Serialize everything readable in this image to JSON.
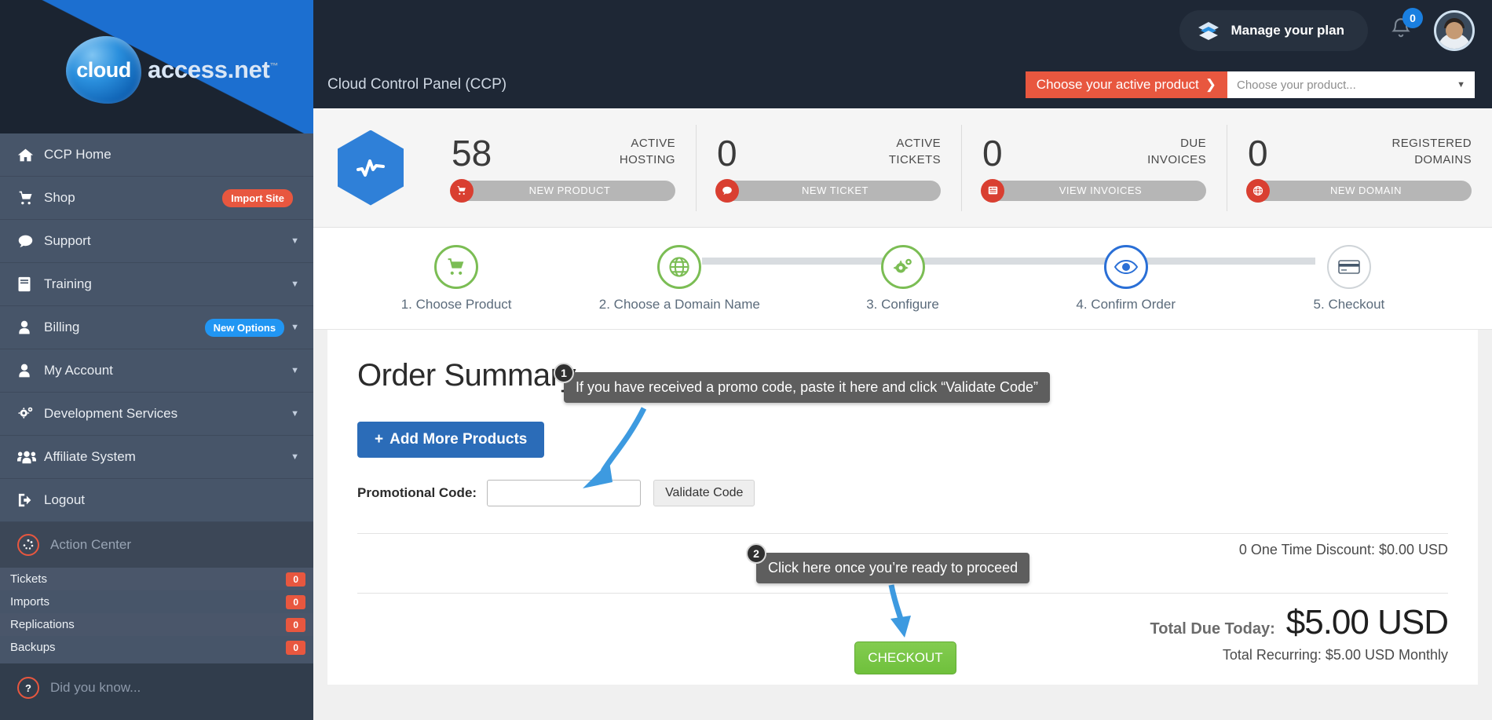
{
  "brand": {
    "logo_primary": "cloud",
    "logo_secondary": "access.net",
    "logo_tm": "™",
    "accent_blue": "#1c6fd0",
    "accent_red": "#e8573f",
    "accent_green": "#7bbd54"
  },
  "sidebar": {
    "items": [
      {
        "label": "CCP Home",
        "icon": "home-icon",
        "badge": null,
        "caret": false
      },
      {
        "label": "Shop",
        "icon": "cart-icon",
        "badge": "Import Site",
        "badge_color": "red",
        "caret": false
      },
      {
        "label": "Support",
        "icon": "chat-icon",
        "badge": null,
        "caret": true
      },
      {
        "label": "Training",
        "icon": "book-icon",
        "badge": null,
        "caret": true
      },
      {
        "label": "Billing",
        "icon": "user-icon",
        "badge": "New Options",
        "badge_color": "blue",
        "caret": true
      },
      {
        "label": "My Account",
        "icon": "user-icon",
        "badge": null,
        "caret": true
      },
      {
        "label": "Development Services",
        "icon": "gears-icon",
        "badge": null,
        "caret": true
      },
      {
        "label": "Affiliate System",
        "icon": "users-icon",
        "badge": null,
        "caret": true
      },
      {
        "label": "Logout",
        "icon": "logout-icon",
        "badge": null,
        "caret": false
      }
    ],
    "action_center": {
      "label": "Action Center",
      "icon": "spinner-circle-icon"
    },
    "counters": [
      {
        "label": "Tickets",
        "count": "0"
      },
      {
        "label": "Imports",
        "count": "0"
      },
      {
        "label": "Replications",
        "count": "0"
      },
      {
        "label": "Backups",
        "count": "0"
      }
    ],
    "did_you_know": {
      "label": "Did you know...",
      "icon": "question-circle-icon"
    }
  },
  "topbar": {
    "plan_button": {
      "label": "Manage your plan",
      "icon": "layers-icon"
    },
    "notifications": {
      "icon": "bell-icon",
      "count": "0"
    },
    "avatar": "user-avatar"
  },
  "titlebar": {
    "title": "Cloud Control Panel (CCP)",
    "product_label": "Choose your active product",
    "product_label_chevron": "❯",
    "product_select_value": "Choose your product..."
  },
  "stats": {
    "hex_icon": "pulse-icon",
    "items": [
      {
        "number": "58",
        "caption_line1": "ACTIVE",
        "caption_line2": "HOSTING",
        "button": "NEW PRODUCT",
        "button_icon": "cart-icon"
      },
      {
        "number": "0",
        "caption_line1": "ACTIVE",
        "caption_line2": "TICKETS",
        "button": "NEW TICKET",
        "button_icon": "chat-icon"
      },
      {
        "number": "0",
        "caption_line1": "DUE",
        "caption_line2": "INVOICES",
        "button": "VIEW INVOICES",
        "button_icon": "list-icon"
      },
      {
        "number": "0",
        "caption_line1": "REGISTERED",
        "caption_line2": "DOMAINS",
        "button": "NEW DOMAIN",
        "button_icon": "globe-icon"
      }
    ]
  },
  "stepper": {
    "steps": [
      {
        "label": "1. Choose Product",
        "icon": "cart-icon",
        "state": "complete"
      },
      {
        "label": "2. Choose a Domain Name",
        "icon": "globe-icon",
        "state": "complete"
      },
      {
        "label": "3. Configure",
        "icon": "gears-icon",
        "state": "complete"
      },
      {
        "label": "4. Confirm Order",
        "icon": "eye-icon",
        "state": "active"
      },
      {
        "label": "5. Checkout",
        "icon": "credit-card-icon",
        "state": "inactive"
      }
    ]
  },
  "order": {
    "heading": "Order Summary",
    "add_products_button": "Add More Products",
    "add_products_icon": "plus-icon",
    "promo_label": "Promotional Code:",
    "promo_value": "",
    "promo_placeholder": "",
    "validate_button": "Validate Code",
    "discount_line": "0 One Time Discount: $0.00 USD",
    "total_due_label": "Total Due Today:",
    "total_due_value": "$5.00 USD",
    "total_recurring": "Total Recurring: $5.00 USD Monthly",
    "checkout_button": "CHECKOUT"
  },
  "annotations": [
    {
      "number": "1",
      "text": "If you have received a promo code, paste it here and click “Validate Code”"
    },
    {
      "number": "2",
      "text": "Click here once you’re ready to proceed"
    }
  ]
}
